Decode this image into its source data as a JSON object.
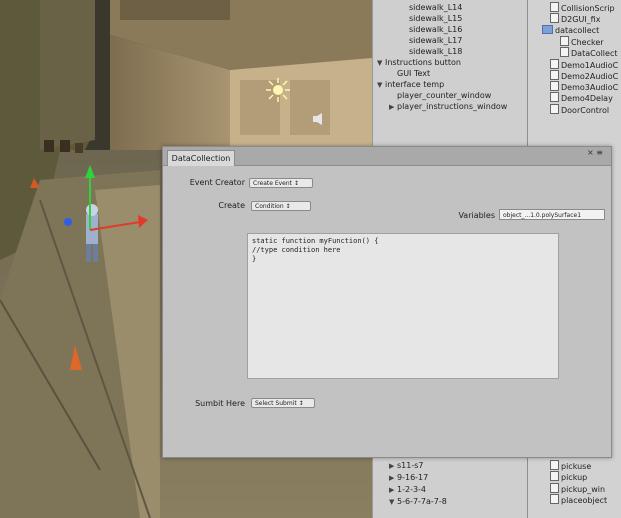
{
  "scene": {
    "light_icon": "sun-icon",
    "audio_icon": "speaker-icon"
  },
  "hierarchy": {
    "top_rows": [
      {
        "label": "sidewalk_L14",
        "indent": 2,
        "expander": ""
      },
      {
        "label": "sidewalk_L15",
        "indent": 2,
        "expander": ""
      },
      {
        "label": "sidewalk_L16",
        "indent": 2,
        "expander": ""
      },
      {
        "label": "sidewalk_L17",
        "indent": 2,
        "expander": ""
      },
      {
        "label": "sidewalk_L18",
        "indent": 2,
        "expander": ""
      },
      {
        "label": "Instructions button",
        "indent": 0,
        "expander": "▼"
      },
      {
        "label": "GUI Text",
        "indent": 1,
        "expander": ""
      },
      {
        "label": "interface temp",
        "indent": 0,
        "expander": "▼"
      },
      {
        "label": "player_counter_window",
        "indent": 1,
        "expander": ""
      },
      {
        "label": "player_instructions_window",
        "indent": 1,
        "expander": "▶"
      }
    ],
    "bottom_rows": [
      {
        "label": "s11-s7",
        "expander": "▶"
      },
      {
        "label": "9-16-17",
        "expander": "▶"
      },
      {
        "label": "1-2-3-4",
        "expander": "▶"
      },
      {
        "label": "5-6-7-7a-7-8",
        "expander": "▼"
      }
    ]
  },
  "project": {
    "top_rows": [
      {
        "label": "CollisionScrip",
        "kind": "file"
      },
      {
        "label": "D2GUI_fix",
        "kind": "file"
      },
      {
        "label": "datacollect",
        "kind": "folder"
      },
      {
        "label": "Checker",
        "kind": "file"
      },
      {
        "label": "DataCollect",
        "kind": "file"
      },
      {
        "label": "Demo1AudioC",
        "kind": "file"
      },
      {
        "label": "Demo2AudioC",
        "kind": "file"
      },
      {
        "label": "Demo3AudioC",
        "kind": "file"
      },
      {
        "label": "Demo4Delay",
        "kind": "file"
      },
      {
        "label": "DoorControl",
        "kind": "file"
      }
    ],
    "bottom_rows": [
      {
        "label": "pickuse",
        "kind": "file"
      },
      {
        "label": "pickup",
        "kind": "file"
      },
      {
        "label": "pickup_win",
        "kind": "file"
      },
      {
        "label": "placeobject",
        "kind": "file"
      }
    ]
  },
  "dialog": {
    "tab_title": "DataCollection",
    "event_creator_label": "Event Creator",
    "event_creator_button": "Create Event ↕",
    "create_label": "Create",
    "create_button": "Condition ↕",
    "variables_label": "Variables",
    "variables_value": "object_...1.0.polySurface1",
    "code_lines": [
      "static function myFunction() {",
      "//type condition here",
      "}"
    ],
    "submit_label": "Sumbit Here",
    "submit_button": "Select Submit ↕"
  }
}
